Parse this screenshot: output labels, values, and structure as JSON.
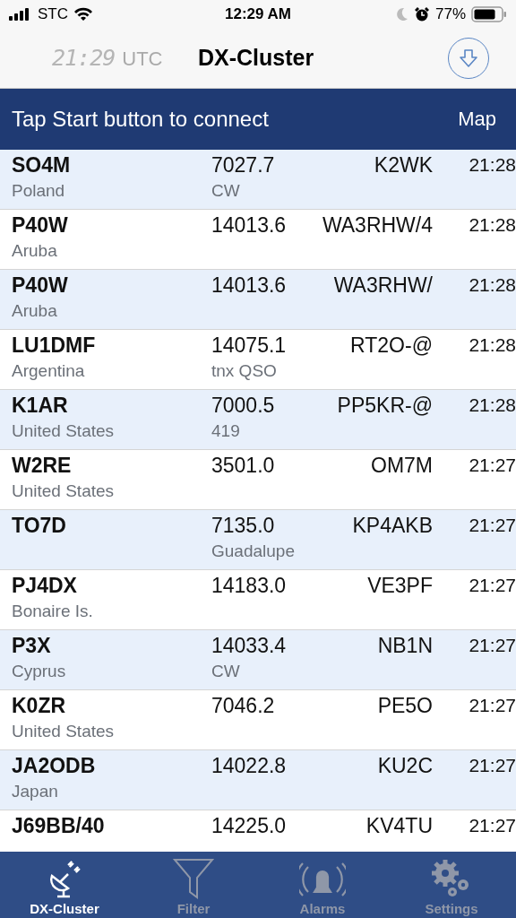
{
  "status_bar": {
    "carrier": "STC",
    "time": "12:29 AM",
    "battery": "77%"
  },
  "nav": {
    "clock": "21:29",
    "clock_unit": "UTC",
    "title": "DX-Cluster"
  },
  "banner": {
    "message": "Tap Start button to connect",
    "map_button": "Map"
  },
  "spots": [
    {
      "call": "SO4M",
      "country": "Poland",
      "freq": "7027.7",
      "comment": "CW",
      "spotter": "K2WK",
      "time": "21:28"
    },
    {
      "call": "P40W",
      "country": "Aruba",
      "freq": "14013.6",
      "spotter": "WA3RHW/4",
      "time": "21:28"
    },
    {
      "call": "P40W",
      "country": "Aruba",
      "freq": "14013.6",
      "spotter": "WA3RHW/",
      "time": "21:28"
    },
    {
      "call": "LU1DMF",
      "country": "Argentina",
      "freq": "14075.1",
      "comment": "tnx QSO",
      "spotter": "RT2O-@",
      "time": "21:28"
    },
    {
      "call": "K1AR",
      "country": "United States",
      "freq": "7000.5",
      "comment": "419",
      "spotter": "PP5KR-@",
      "time": "21:28"
    },
    {
      "call": "W2RE",
      "country": "United States",
      "freq": "3501.0",
      "spotter": "OM7M",
      "time": "21:27"
    },
    {
      "call": "TO7D",
      "freq": "7135.0",
      "comment": "Guadalupe",
      "spotter": "KP4AKB",
      "time": "21:27"
    },
    {
      "call": "PJ4DX",
      "country": "Bonaire Is.",
      "freq": "14183.0",
      "spotter": "VE3PF",
      "time": "21:27"
    },
    {
      "call": "P3X",
      "country": "Cyprus",
      "freq": "14033.4",
      "comment": "CW",
      "spotter": "NB1N",
      "time": "21:27"
    },
    {
      "call": "K0ZR",
      "country": "United States",
      "freq": "7046.2",
      "spotter": "PE5O",
      "time": "21:27"
    },
    {
      "call": "JA2ODB",
      "country": "Japan",
      "freq": "14022.8",
      "spotter": "KU2C",
      "time": "21:27"
    },
    {
      "call": "J69BB/40",
      "freq": "14225.0",
      "spotter": "KV4TU",
      "time": "21:27"
    }
  ],
  "tabs": [
    {
      "label": "DX-Cluster",
      "kind": "cluster",
      "selected": true
    },
    {
      "label": "Filter",
      "kind": "filter",
      "selected": false
    },
    {
      "label": "Alarms",
      "kind": "alarms",
      "selected": false
    },
    {
      "label": "Settings",
      "kind": "settings",
      "selected": false
    }
  ]
}
